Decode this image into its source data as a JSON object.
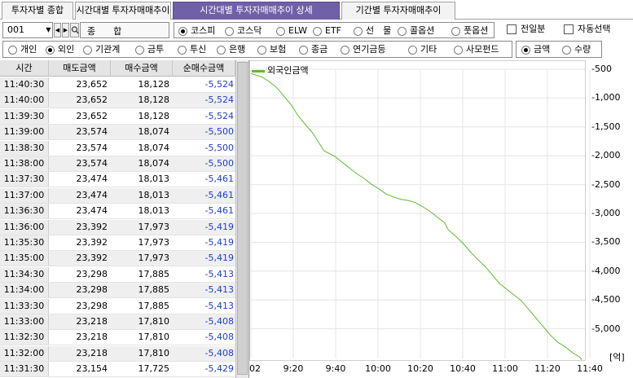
{
  "tabs": [
    "투자자별 종합",
    "시간대별 투자자매매추이",
    "시간대별 투자자매매추이 상세",
    "기간별 투자자매매추이"
  ],
  "code_input": "001",
  "code_name": "종　　합",
  "market_options": [
    "코스피",
    "코스닥",
    "ELW",
    "ETF",
    "선　물",
    "콜옵션",
    "풋옵션"
  ],
  "market_selected": 0,
  "checks": [
    "전일분",
    "자동선택"
  ],
  "investor_options": [
    "개인",
    "외인",
    "기관계",
    "금투",
    "투신",
    "은행",
    "보험",
    "종금",
    "연기금등",
    "기타",
    "사모펀드"
  ],
  "investor_selected": 1,
  "unit_options": [
    "금액",
    "수량"
  ],
  "unit_selected": 0,
  "table": {
    "headers": [
      "시간",
      "매도금액",
      "매수금액",
      "순매수금액"
    ],
    "rows": [
      [
        "11:40:30",
        "23,652",
        "18,128",
        "-5,524"
      ],
      [
        "11:40:00",
        "23,652",
        "18,128",
        "-5,524"
      ],
      [
        "11:39:30",
        "23,652",
        "18,128",
        "-5,524"
      ],
      [
        "11:39:00",
        "23,574",
        "18,074",
        "-5,500"
      ],
      [
        "11:38:30",
        "23,574",
        "18,074",
        "-5,500"
      ],
      [
        "11:38:00",
        "23,574",
        "18,074",
        "-5,500"
      ],
      [
        "11:37:30",
        "23,474",
        "18,013",
        "-5,461"
      ],
      [
        "11:37:00",
        "23,474",
        "18,013",
        "-5,461"
      ],
      [
        "11:36:30",
        "23,474",
        "18,013",
        "-5,461"
      ],
      [
        "11:36:00",
        "23,392",
        "17,973",
        "-5,419"
      ],
      [
        "11:35:30",
        "23,392",
        "17,973",
        "-5,419"
      ],
      [
        "11:35:00",
        "23,392",
        "17,973",
        "-5,419"
      ],
      [
        "11:34:30",
        "23,298",
        "17,885",
        "-5,413"
      ],
      [
        "11:34:00",
        "23,298",
        "17,885",
        "-5,413"
      ],
      [
        "11:33:30",
        "23,298",
        "17,885",
        "-5,413"
      ],
      [
        "11:33:00",
        "23,218",
        "17,810",
        "-5,408"
      ],
      [
        "11:32:30",
        "23,218",
        "17,810",
        "-5,408"
      ],
      [
        "11:32:00",
        "23,218",
        "17,810",
        "-5,408"
      ],
      [
        "11:31:30",
        "23,154",
        "17,725",
        "-5,429"
      ],
      [
        "11:31:00",
        "23,154",
        "17,725",
        "-5,429"
      ]
    ]
  },
  "chart_data": {
    "type": "line",
    "legend": "외국인금액",
    "unit_label": "[억]",
    "x_ticks": [
      "02",
      "9:20",
      "9:40",
      "10:00",
      "10:20",
      "10:40",
      "11:00",
      "11:20",
      "11:40"
    ],
    "y_ticks": [
      "-500",
      "-1,000",
      "-1,500",
      "-2,000",
      "-2,500",
      "-3,000",
      "-3,500",
      "-4,000",
      "-4,500",
      "-5,000"
    ],
    "ylim": [
      -5500,
      -500
    ],
    "grid": true,
    "colors": {
      "line": "#5dbb2e",
      "grid": "#e4e4e4"
    },
    "series": [
      {
        "values": [
          [
            0,
            -560
          ],
          [
            6,
            -620
          ],
          [
            10,
            -700
          ],
          [
            14,
            -800
          ],
          [
            18,
            -950
          ],
          [
            22,
            -1100
          ],
          [
            26,
            -1300
          ],
          [
            30,
            -1450
          ],
          [
            34,
            -1600
          ],
          [
            38,
            -1800
          ],
          [
            40,
            -1900
          ],
          [
            46,
            -2000
          ],
          [
            50,
            -2100
          ],
          [
            54,
            -2200
          ],
          [
            58,
            -2300
          ],
          [
            62,
            -2380
          ],
          [
            66,
            -2480
          ],
          [
            70,
            -2560
          ],
          [
            74,
            -2650
          ],
          [
            78,
            -2700
          ],
          [
            82,
            -2740
          ],
          [
            86,
            -2760
          ],
          [
            90,
            -2800
          ],
          [
            94,
            -2870
          ],
          [
            98,
            -2950
          ],
          [
            102,
            -3050
          ],
          [
            106,
            -3150
          ],
          [
            108,
            -3270
          ],
          [
            112,
            -3380
          ],
          [
            116,
            -3500
          ],
          [
            120,
            -3650
          ],
          [
            124,
            -3780
          ],
          [
            128,
            -3900
          ],
          [
            132,
            -4050
          ],
          [
            136,
            -4200
          ],
          [
            140,
            -4300
          ],
          [
            144,
            -4400
          ],
          [
            148,
            -4500
          ],
          [
            152,
            -4650
          ],
          [
            156,
            -4800
          ],
          [
            160,
            -4950
          ],
          [
            164,
            -5100
          ],
          [
            168,
            -5220
          ],
          [
            172,
            -5300
          ],
          [
            176,
            -5400
          ],
          [
            180,
            -5480
          ],
          [
            181,
            -5524
          ]
        ]
      }
    ]
  }
}
